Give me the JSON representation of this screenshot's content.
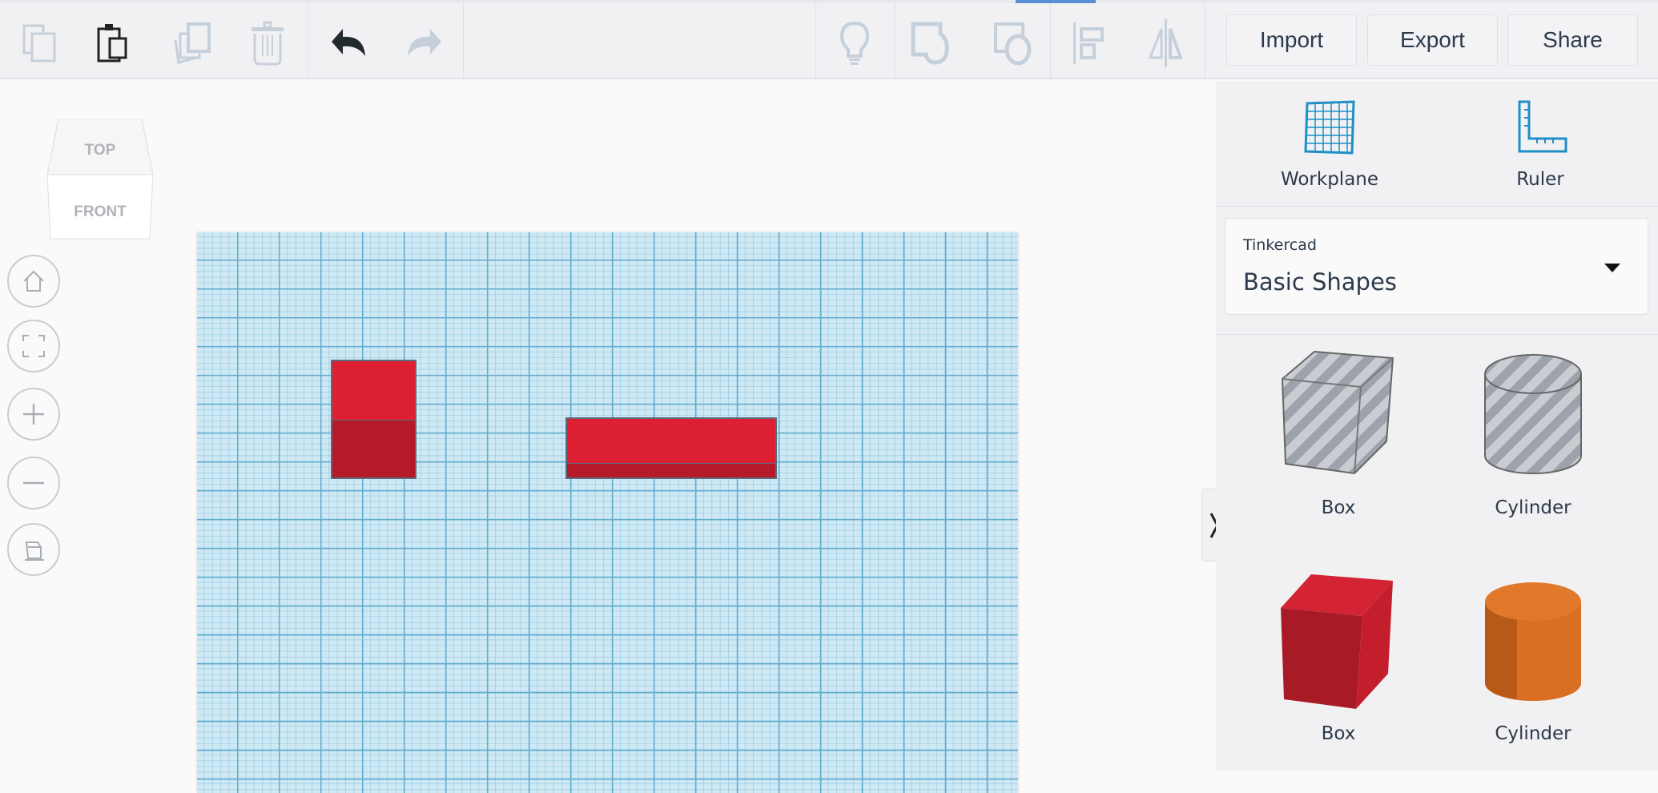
{
  "toolbar": {
    "left_icons": [
      "copy-icon",
      "paste-icon",
      "duplicate-icon",
      "delete-icon",
      "undo-icon",
      "redo-icon"
    ],
    "right_icons": [
      "lightbulb-icon",
      "group-icon",
      "ungroup-icon",
      "align-icon",
      "mirror-icon"
    ],
    "import_label": "Import",
    "export_label": "Export",
    "share_label": "Share"
  },
  "viewcube": {
    "top": "TOP",
    "front": "FRONT"
  },
  "nav_icons": [
    "home-icon",
    "fit-view-icon",
    "zoom-in-icon",
    "zoom-out-icon",
    "perspective-icon"
  ],
  "panel": {
    "workplane_label": "Workplane",
    "ruler_label": "Ruler",
    "library": {
      "source": "Tinkercad",
      "selected": "Basic Shapes"
    },
    "shapes": [
      {
        "label": "Box",
        "style": "hole"
      },
      {
        "label": "Cylinder",
        "style": "hole"
      },
      {
        "label": "Box",
        "color": "#c41e2c"
      },
      {
        "label": "Cylinder",
        "color": "#e07a2a"
      }
    ]
  },
  "colors": {
    "accent": "#1f8fc6",
    "object_red": "#dc1f31",
    "workplane": "#cfe9f4"
  }
}
